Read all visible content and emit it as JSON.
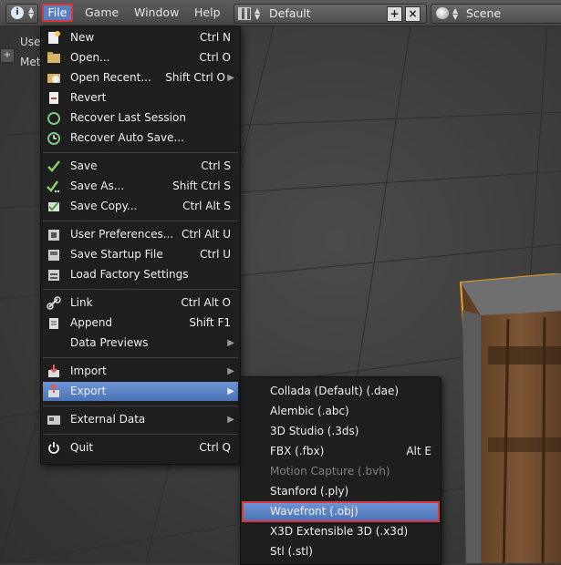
{
  "header": {
    "info_menu_arrows": "▲▼",
    "menus": [
      "File",
      "Game",
      "Window",
      "Help"
    ],
    "layout_value": "Default",
    "scene_value": "Scene"
  },
  "viewport": {
    "lines": [
      "User",
      "Meti"
    ],
    "plus_label": "+"
  },
  "file_menu": {
    "items": [
      {
        "label": "New",
        "shortcut": "Ctrl N",
        "icon": "new-file-icon"
      },
      {
        "label": "Open...",
        "shortcut": "Ctrl O",
        "icon": "folder-open-icon"
      },
      {
        "label": "Open Recent...",
        "shortcut": "Shift Ctrl O",
        "icon": "open-recent-icon",
        "submenu": true
      },
      {
        "label": "Revert",
        "shortcut": "",
        "icon": "revert-icon"
      },
      {
        "label": "Recover Last Session",
        "shortcut": "",
        "icon": "recover-icon"
      },
      {
        "label": "Recover Auto Save...",
        "shortcut": "",
        "icon": "recover-autosave-icon"
      },
      {
        "label": "Save",
        "shortcut": "Ctrl S",
        "icon": "checkmark-icon"
      },
      {
        "label": "Save As...",
        "shortcut": "Shift Ctrl S",
        "icon": "checkmark-dots-icon"
      },
      {
        "label": "Save Copy...",
        "shortcut": "Ctrl Alt S",
        "icon": "save-copy-icon"
      },
      {
        "label": "User Preferences...",
        "shortcut": "Ctrl Alt U",
        "icon": "preferences-icon"
      },
      {
        "label": "Save Startup File",
        "shortcut": "Ctrl U",
        "icon": "save-startup-icon"
      },
      {
        "label": "Load Factory Settings",
        "shortcut": "",
        "icon": "factory-settings-icon"
      },
      {
        "label": "Link",
        "shortcut": "Ctrl Alt O",
        "icon": "link-icon"
      },
      {
        "label": "Append",
        "shortcut": "Shift F1",
        "icon": "append-icon"
      },
      {
        "label": "Data Previews",
        "shortcut": "",
        "icon": "",
        "submenu": true
      },
      {
        "label": "Import",
        "shortcut": "",
        "icon": "import-icon",
        "submenu": true
      },
      {
        "label": "Export",
        "shortcut": "",
        "icon": "export-icon",
        "submenu": true,
        "highlighted": true
      },
      {
        "label": "External Data",
        "shortcut": "",
        "icon": "external-data-icon",
        "submenu": true
      },
      {
        "label": "Quit",
        "shortcut": "Ctrl Q",
        "icon": "power-icon"
      }
    ]
  },
  "export_menu": {
    "items": [
      {
        "label": "Collada (Default) (.dae)",
        "shortcut": ""
      },
      {
        "label": "Alembic (.abc)",
        "shortcut": ""
      },
      {
        "label": "3D Studio (.3ds)",
        "shortcut": ""
      },
      {
        "label": "FBX (.fbx)",
        "shortcut": "Alt E"
      },
      {
        "label": "Motion Capture (.bvh)",
        "shortcut": "",
        "disabled": true
      },
      {
        "label": "Stanford (.ply)",
        "shortcut": ""
      },
      {
        "label": "Wavefront (.obj)",
        "shortcut": "",
        "selected": true
      },
      {
        "label": "X3D Extensible 3D (.x3d)",
        "shortcut": ""
      },
      {
        "label": "Stl (.stl)",
        "shortcut": ""
      }
    ]
  },
  "colors": {
    "highlight": "#5680c2",
    "annotation_box": "#d9363e",
    "menu_bg": "#1c1c1c"
  }
}
